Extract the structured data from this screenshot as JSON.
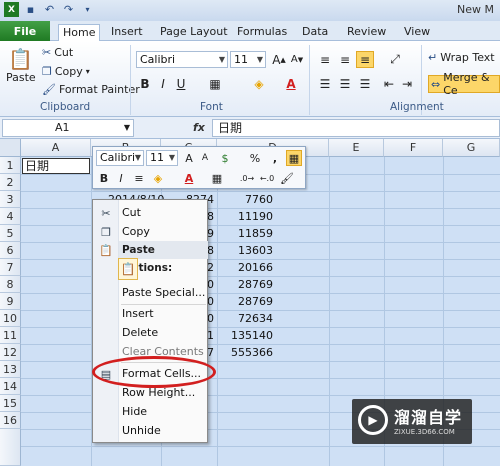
{
  "window": {
    "title": "New M"
  },
  "qat": {
    "save_icon": "save-icon",
    "undo_icon": "undo-icon",
    "redo_icon": "redo-icon"
  },
  "tabs": [
    "File",
    "Home",
    "Insert",
    "Page Layout",
    "Formulas",
    "Data",
    "Review",
    "View"
  ],
  "active_tab": "Home",
  "ribbon": {
    "clipboard": {
      "label": "Clipboard",
      "paste": "Paste",
      "cut": "Cut",
      "copy": "Copy",
      "format_painter": "Format Painter"
    },
    "font": {
      "label": "Font",
      "name": "Calibri",
      "size": "11"
    },
    "alignment": {
      "label": "Alignment",
      "wrap_text": "Wrap Text",
      "merge": "Merge & Ce"
    }
  },
  "formula_bar": {
    "name_box": "A1",
    "fx": "fx",
    "content": "日期"
  },
  "grid": {
    "columns": [
      "A",
      "B",
      "C",
      "D",
      "E",
      "F",
      "G"
    ],
    "rows": [
      "1",
      "2",
      "3",
      "4",
      "5",
      "6",
      "7",
      "8",
      "9",
      "10",
      "11",
      "12",
      "13",
      "14",
      "15",
      "16"
    ],
    "a1": "日期",
    "partial_date": "2014/8/10",
    "col_b_fragments": [
      "8274",
      "8",
      "9",
      "8",
      "72",
      "0",
      "0",
      "70",
      "1",
      "7"
    ],
    "col_c_values": [
      "7760",
      "11190",
      "11859",
      "13603",
      "20166",
      "28769",
      "28769",
      "72634",
      "135140",
      "555366"
    ]
  },
  "mini_toolbar": {
    "font": "Calibri",
    "size": "11",
    "percent": "%",
    "comma": ","
  },
  "context_menu": {
    "cut": "Cut",
    "copy": "Copy",
    "paste_options": "Paste Options:",
    "paste_special": "Paste Special...",
    "insert": "Insert",
    "delete": "Delete",
    "clear_contents": "Clear Contents",
    "format_cells": "Format Cells...",
    "row_height": "Row Height...",
    "hide": "Hide",
    "unhide": "Unhide"
  },
  "annotation_color": "#d21f1f",
  "watermark": {
    "title": "溜溜自学",
    "subtitle": "ZIXUE.3D66.COM"
  }
}
